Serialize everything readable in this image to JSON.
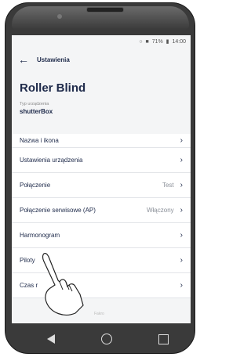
{
  "status": {
    "signal": "■",
    "battery_pct": "71%",
    "battery_icon": "▮",
    "time": "14:00",
    "wifi": "○"
  },
  "appbar": {
    "title": "Ustawienia"
  },
  "device": {
    "name": "Roller Blind",
    "type_label": "Typ urządzenia",
    "type_value": "shutterBox"
  },
  "list": [
    {
      "label": "Nazwa i ikona",
      "value": ""
    },
    {
      "label": "Ustawienia urządzenia",
      "value": ""
    },
    {
      "label": "Połączenie",
      "value": "Test"
    },
    {
      "label": "Połączenie serwisowe (AP)",
      "value": "Włączony"
    },
    {
      "label": "Harmonogram",
      "value": ""
    },
    {
      "label": "Piloty",
      "value": ""
    },
    {
      "label": "Czas r",
      "value": ""
    }
  ],
  "chevron": "›",
  "brand": "Fakro"
}
